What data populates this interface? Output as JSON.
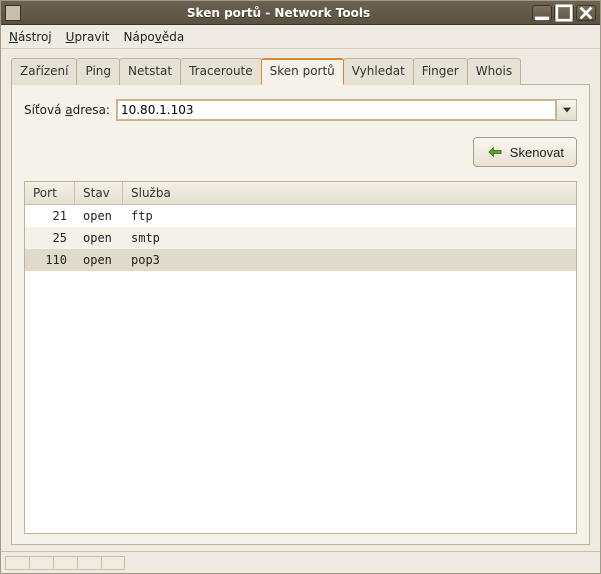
{
  "window": {
    "title": "Sken portů - Network Tools"
  },
  "menu": {
    "tool": "Nástroj",
    "edit": "Upravit",
    "help": "Nápověda"
  },
  "tabs": {
    "devices": "Zařízení",
    "ping": "Ping",
    "netstat": "Netstat",
    "traceroute": "Traceroute",
    "portscan": "Sken portů",
    "lookup": "Vyhledat",
    "finger": "Finger",
    "whois": "Whois"
  },
  "address": {
    "label_pre": "Síťová ",
    "label_ul": "a",
    "label_post": "dresa:",
    "value": "10.80.1.103"
  },
  "scan": {
    "label": "Skenovat"
  },
  "columns": {
    "port": "Port",
    "state": "Stav",
    "service": "Služba"
  },
  "rows": [
    {
      "port": "21",
      "state": "open",
      "service": "ftp"
    },
    {
      "port": "25",
      "state": "open",
      "service": "smtp"
    },
    {
      "port": "110",
      "state": "open",
      "service": "pop3"
    }
  ]
}
